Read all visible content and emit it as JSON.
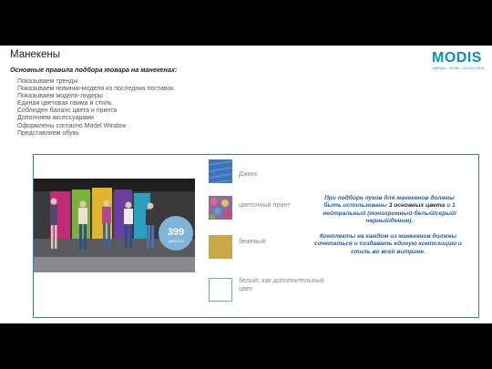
{
  "header": {
    "title": "Манекены",
    "subtitle": "Основные правила подбора товара на манекенах:"
  },
  "rules": [
    "Показываем тренды",
    "Показываем новинки-модели из последних поставок",
    "Показываем модели-лидеры",
    "Единая цветовая гамма и стиль",
    "Соблюден баланс цвета и принта",
    "Дополняем аксессуарами",
    "Оформлены согласно Model Window",
    "Представляем обувь"
  ],
  "rule_marker": "",
  "logo": {
    "word": "MODIS",
    "tagline": "ОДЕЖДА • ОБУВЬ • АКСЕССУАРЫ"
  },
  "photo": {
    "price_sign": "399",
    "price_sub": "ДЖИНСЫ"
  },
  "swatches": [
    {
      "label": "Джинс",
      "color": "#3d73b8"
    },
    {
      "label": "цветочный принт",
      "color": "#b77aa0"
    },
    {
      "label": "бежевый",
      "color": "#c9a84a"
    },
    {
      "label": "белый, как дополнительный цвет",
      "color": "#ffffff",
      "border": "#6fa6d6"
    }
  ],
  "notes": {
    "note1_pre": "При подборе луков для манекенов должны быть использованы",
    "note1_bold": "3 основных цвета",
    "note1_post": "и 1 нейтральный (монохромный-белый/серый/черный/деним).",
    "note2": "Комплекты на каждом из манекенов должны сочетаться и создавать единую композицию и стиль во всей витрине."
  },
  "colors": {
    "frame": "#3b78b6",
    "brand": "#0a8fbf",
    "note_text": "#1f5fa8"
  }
}
